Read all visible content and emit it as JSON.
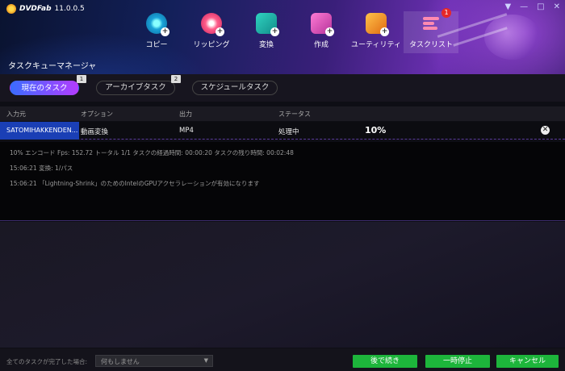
{
  "app": {
    "name": "DVDFab",
    "version": "11.0.0.5"
  },
  "window_controls": [
    "▼",
    "—",
    "□",
    "✕"
  ],
  "nav": [
    {
      "label": "コピー",
      "icon": "copy-disc-icon"
    },
    {
      "label": "リッピング",
      "icon": "ripper-disc-icon"
    },
    {
      "label": "変換",
      "icon": "converter-icon"
    },
    {
      "label": "作成",
      "icon": "creator-icon"
    },
    {
      "label": "ユーティリティ",
      "icon": "utility-folder-icon"
    },
    {
      "label": "タスクリスト",
      "icon": "task-list-icon",
      "badge": "1",
      "active": true
    }
  ],
  "section_title": "タスクキューマネージャ",
  "tabs": [
    {
      "label": "現在のタスク",
      "count": "1",
      "active": true
    },
    {
      "label": "アーカイブタスク",
      "count": "2"
    },
    {
      "label": "スケジュールタスク"
    }
  ],
  "columns": [
    "入力元",
    "オプション",
    "出力",
    "ステータス"
  ],
  "task": {
    "source": "SATOMIHAKKENDEN...",
    "option": "動画変換",
    "output": "MP4",
    "status": "処理中",
    "progress": "10%"
  },
  "log": [
    "10%  エンコード Fps: 152.72   トータル  1/1  タスクの経過時間: 00:00:20  タスクの残り時間: 00:02:48",
    "15:06:21    変換: 1/パス",
    "15:06:21    「Lightning-Shrink」のためのIntelのGPUアクセラレーションが有効になります"
  ],
  "footer": {
    "label": "全てのタスクが完了した場合:",
    "select_value": "何もしません",
    "buttons": [
      "後で続き",
      "一時停止",
      "キャンセル"
    ]
  },
  "colors": {
    "accent_green": "#1db53b",
    "active_source": "#1a3fb5",
    "badge_red": "#e52828"
  }
}
